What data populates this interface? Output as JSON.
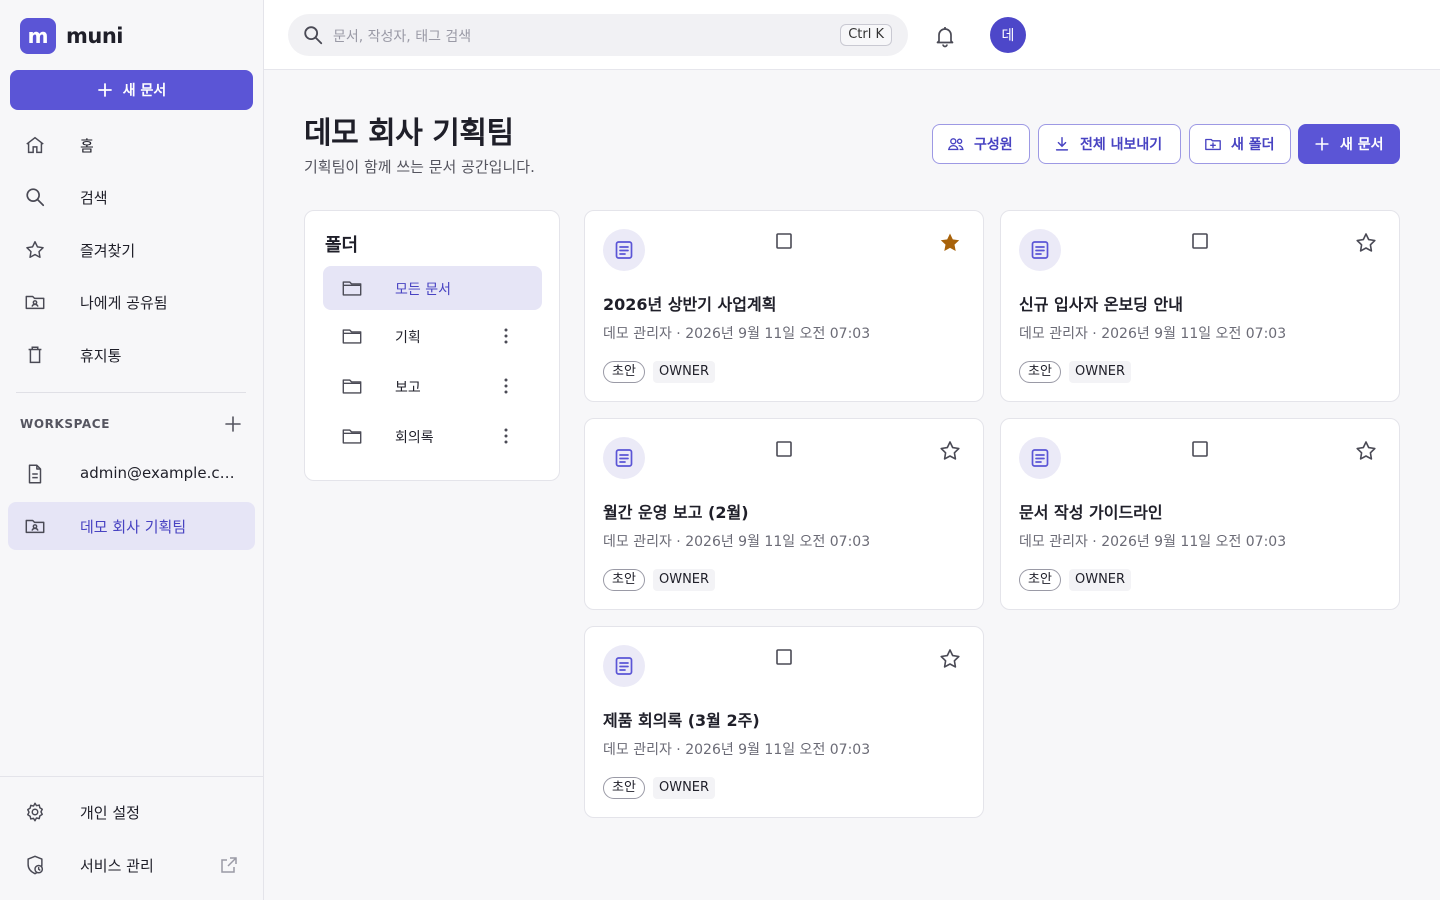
{
  "brand": {
    "logo_letter": "m",
    "name": "muni"
  },
  "sidebar": {
    "new_doc_label": "새 문서",
    "nav": [
      {
        "label": "홈",
        "icon": "home-icon"
      },
      {
        "label": "검색",
        "icon": "search-icon"
      },
      {
        "label": "즐겨찾기",
        "icon": "star-icon"
      },
      {
        "label": "나에게 공유됨",
        "icon": "shared-folder-icon"
      },
      {
        "label": "휴지통",
        "icon": "trash-icon"
      }
    ],
    "workspace_label": "WORKSPACE",
    "workspaces": [
      {
        "label": "admin@example.com",
        "icon": "document-icon",
        "active": false
      },
      {
        "label": "데모 회사 기획팀",
        "icon": "shared-folder-icon",
        "active": true
      }
    ],
    "bottom": [
      {
        "label": "개인 설정",
        "icon": "gear-icon"
      },
      {
        "label": "서비스 관리",
        "icon": "admin-shield-icon"
      }
    ]
  },
  "topbar": {
    "search_placeholder": "문서, 작성자, 태그 검색",
    "shortcut": "Ctrl K",
    "avatar_initial": "데"
  },
  "header": {
    "title": "데모 회사 기획팀",
    "subtitle": "기획팀이 함께 쓰는 문서 공간입니다.",
    "buttons": {
      "members": "구성원",
      "export": "전체 내보내기",
      "new_folder": "새 폴더",
      "new_doc": "새 문서"
    }
  },
  "folders": {
    "title": "폴더",
    "items": [
      {
        "label": "모든 문서",
        "active": true
      },
      {
        "label": "기획",
        "active": false
      },
      {
        "label": "보고",
        "active": false
      },
      {
        "label": "회의록",
        "active": false
      }
    ]
  },
  "documents": [
    {
      "title": "2026년 상반기 사업계획",
      "author": "데모 관리자",
      "date": "2026년 9월 11일 오전 07:03",
      "status": "초안",
      "role": "OWNER",
      "starred": true
    },
    {
      "title": "신규 입사자 온보딩 안내",
      "author": "데모 관리자",
      "date": "2026년 9월 11일 오전 07:03",
      "status": "초안",
      "role": "OWNER",
      "starred": false
    },
    {
      "title": "월간 운영 보고 (2월)",
      "author": "데모 관리자",
      "date": "2026년 9월 11일 오전 07:03",
      "status": "초안",
      "role": "OWNER",
      "starred": false
    },
    {
      "title": "문서 작성 가이드라인",
      "author": "데모 관리자",
      "date": "2026년 9월 11일 오전 07:03",
      "status": "초안",
      "role": "OWNER",
      "starred": false
    },
    {
      "title": "제품 회의록 (3월 2주)",
      "author": "데모 관리자",
      "date": "2026년 9월 11일 오전 07:03",
      "status": "초안",
      "role": "OWNER",
      "starred": false
    }
  ],
  "meta_separator": " · ",
  "colors": {
    "accent": "#5b55d6",
    "accent_soft": "#e6e5f6",
    "star_on": "#a8620a"
  }
}
